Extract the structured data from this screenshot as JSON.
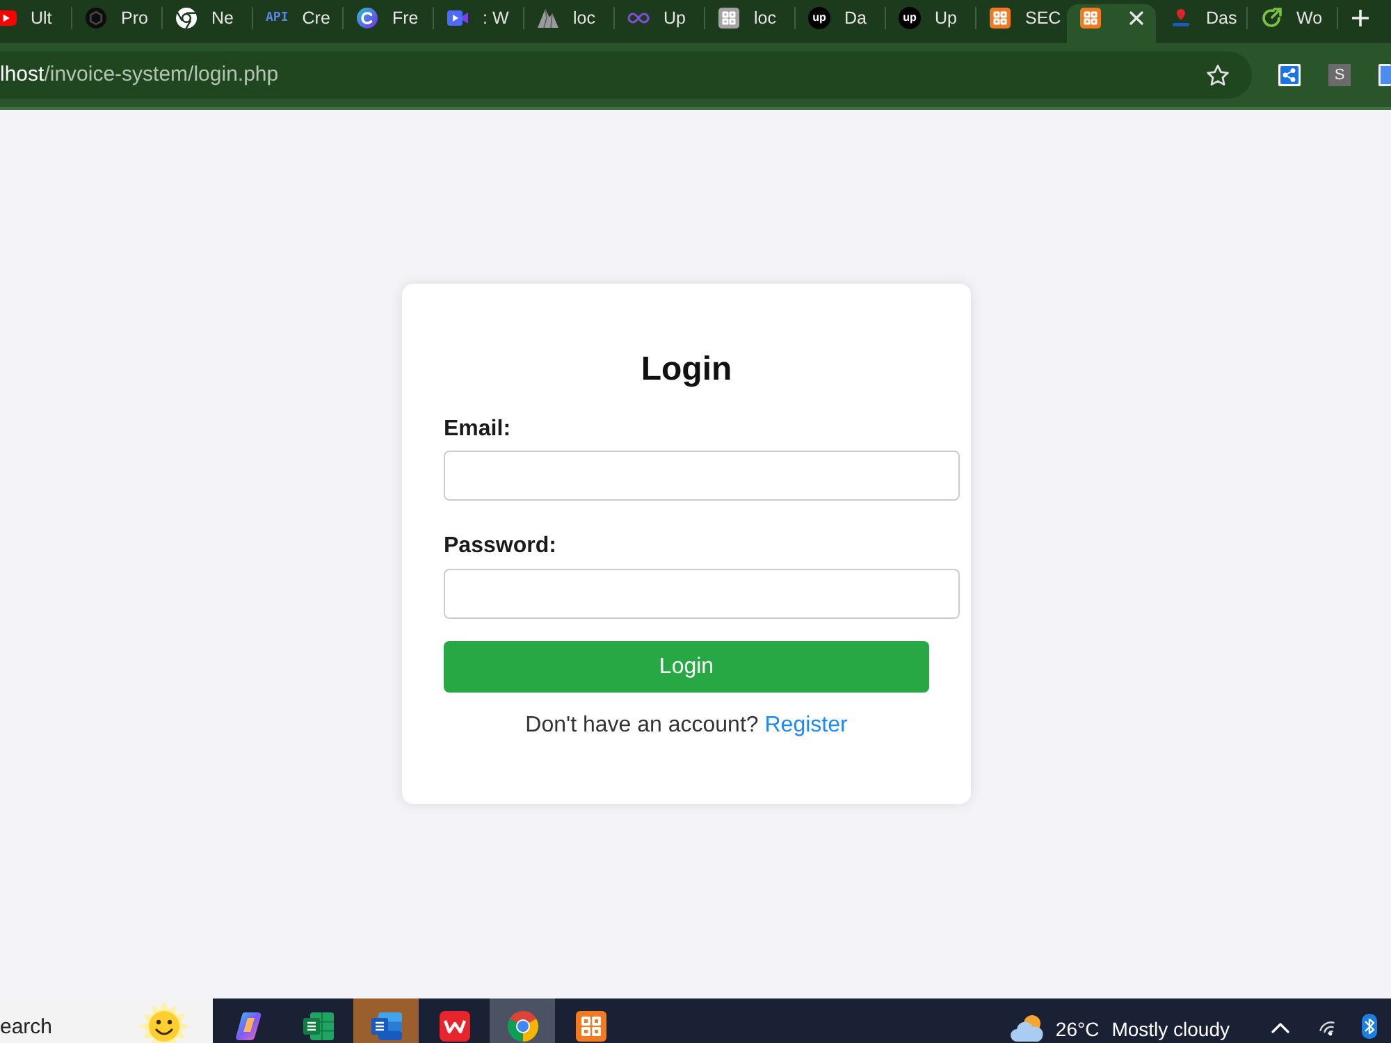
{
  "browser": {
    "tabs": [
      {
        "title": "Ult",
        "selected": false
      },
      {
        "title": "Pro",
        "selected": false
      },
      {
        "title": "Ne",
        "selected": false
      },
      {
        "icon_text": "API",
        "title": "Cre",
        "selected": false
      },
      {
        "title": "Fre",
        "selected": false
      },
      {
        "title": ": W",
        "selected": false
      },
      {
        "title": "loc",
        "selected": false
      },
      {
        "title": "Up",
        "selected": false
      },
      {
        "title": "loc",
        "selected": false
      },
      {
        "icon_text": "up",
        "title": "Da",
        "selected": false
      },
      {
        "icon_text": "up",
        "title": "Up",
        "selected": false
      },
      {
        "title": "SEC",
        "selected": false
      },
      {
        "selected": true
      },
      {
        "title": "Das",
        "selected": false
      },
      {
        "title": "Wo",
        "selected": false
      }
    ],
    "address_bar": {
      "host": "lhost",
      "path": "/invoice-system/login.php"
    },
    "extension_letter": "S"
  },
  "login_form": {
    "title": "Login",
    "fields": [
      {
        "label": "Email:"
      },
      {
        "label": "Password:"
      }
    ],
    "submit": "Login",
    "footer": {
      "text": "Don't have an account?",
      "link": "Register"
    }
  },
  "taskbar": {
    "search": "earch",
    "apps": [
      {
        "selected": false,
        "attention": false
      },
      {
        "selected": false,
        "attention": false
      },
      {
        "selected": false,
        "attention": true
      },
      {
        "selected": false,
        "attention": false
      },
      {
        "selected": true,
        "attention": false
      },
      {
        "selected": false,
        "attention": false
      }
    ],
    "weather": {
      "temperature": "26°C",
      "condition": "Mostly cloudy"
    }
  }
}
